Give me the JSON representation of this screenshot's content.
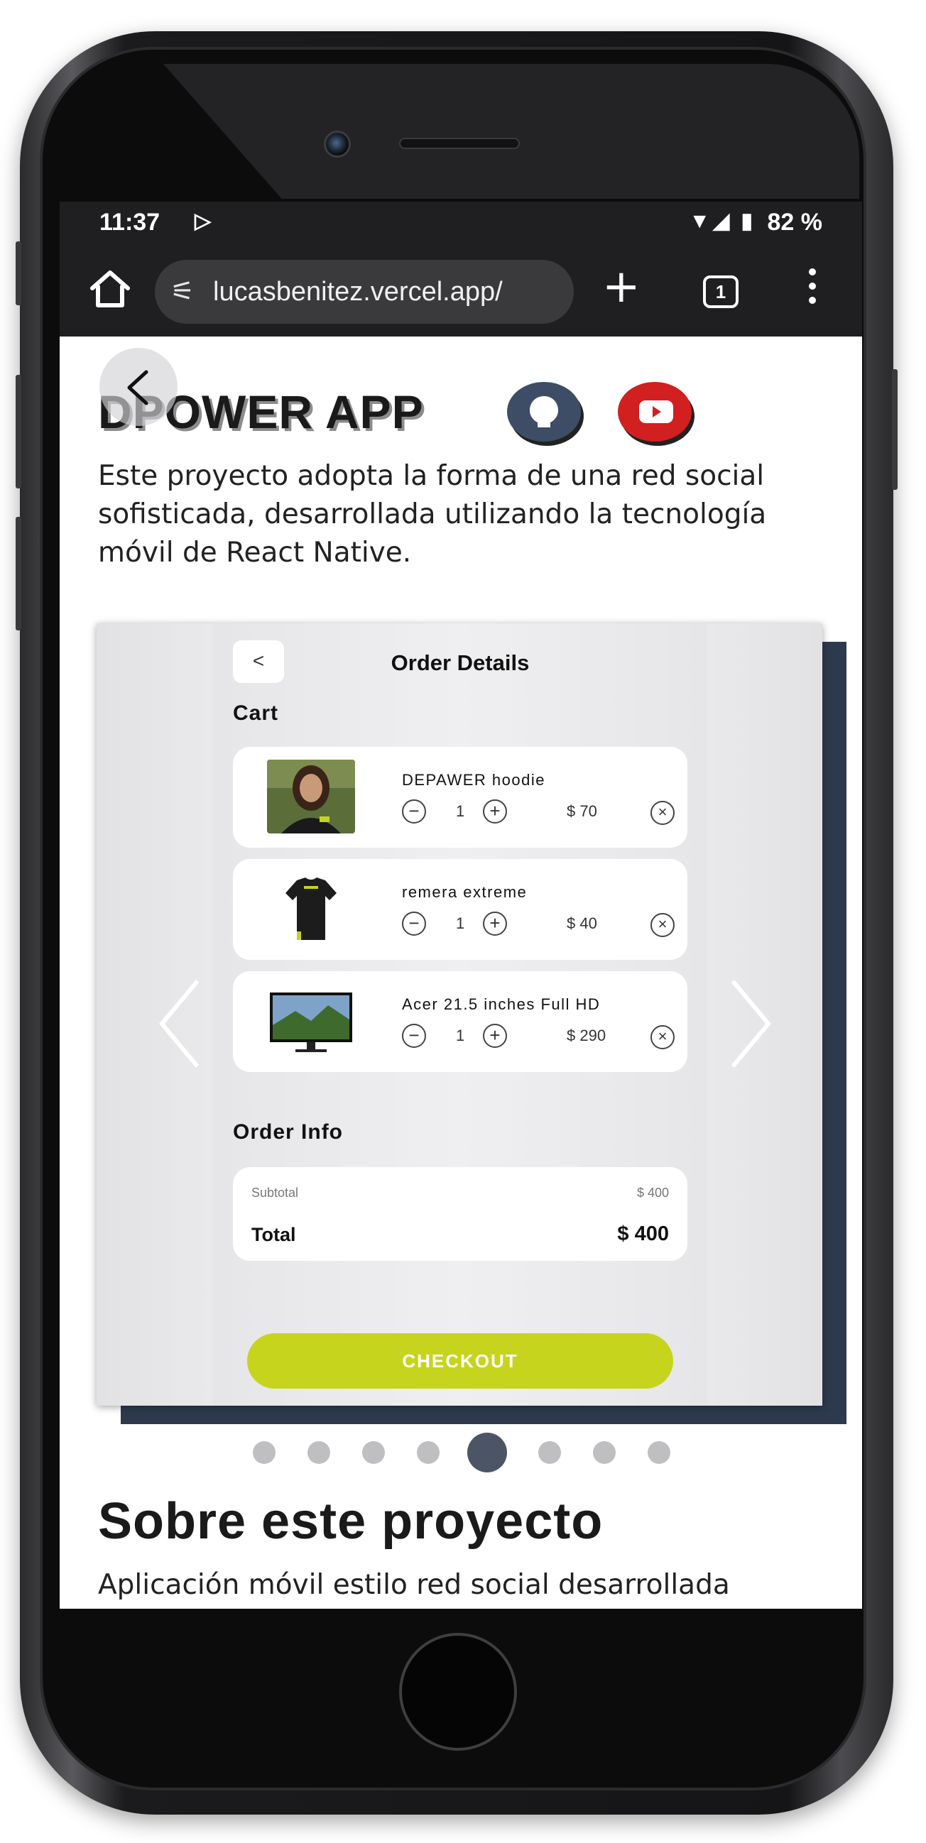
{
  "status_bar": {
    "time": "11:37",
    "battery": "82 %"
  },
  "browser": {
    "url": "lucasbenitez.vercel.app/",
    "tab_count": "1"
  },
  "project": {
    "title": "DPOWER APP",
    "description": "Este proyecto adopta la forma de una red social sofisticada, desarrollada utilizando la tecnología móvil de React Native."
  },
  "app_screen": {
    "title": "Order Details",
    "back_label": "<",
    "cart_label": "Cart",
    "items": [
      {
        "name": "DEPAWER hoodie",
        "qty": "1",
        "price": "$ 70"
      },
      {
        "name": "remera extreme",
        "qty": "1",
        "price": "$ 40"
      },
      {
        "name": "Acer 21.5 inches Full HD",
        "qty": "1",
        "price": "$ 290"
      }
    ],
    "order_info_label": "Order Info",
    "subtotal_label": "Subtotal",
    "subtotal_value": "$ 400",
    "total_label": "Total",
    "total_value": "$ 400",
    "checkout_label": "CHECKOUT"
  },
  "carousel": {
    "slide_count": 8,
    "active_index": 4
  },
  "about": {
    "heading": "Sobre este proyecto",
    "text": "Aplicación móvil estilo red social desarrollada"
  },
  "colors": {
    "checkout": "#c6d41e",
    "github": "#3e4d66",
    "youtube": "#d21f1f",
    "active_dot": "#4b5566"
  }
}
